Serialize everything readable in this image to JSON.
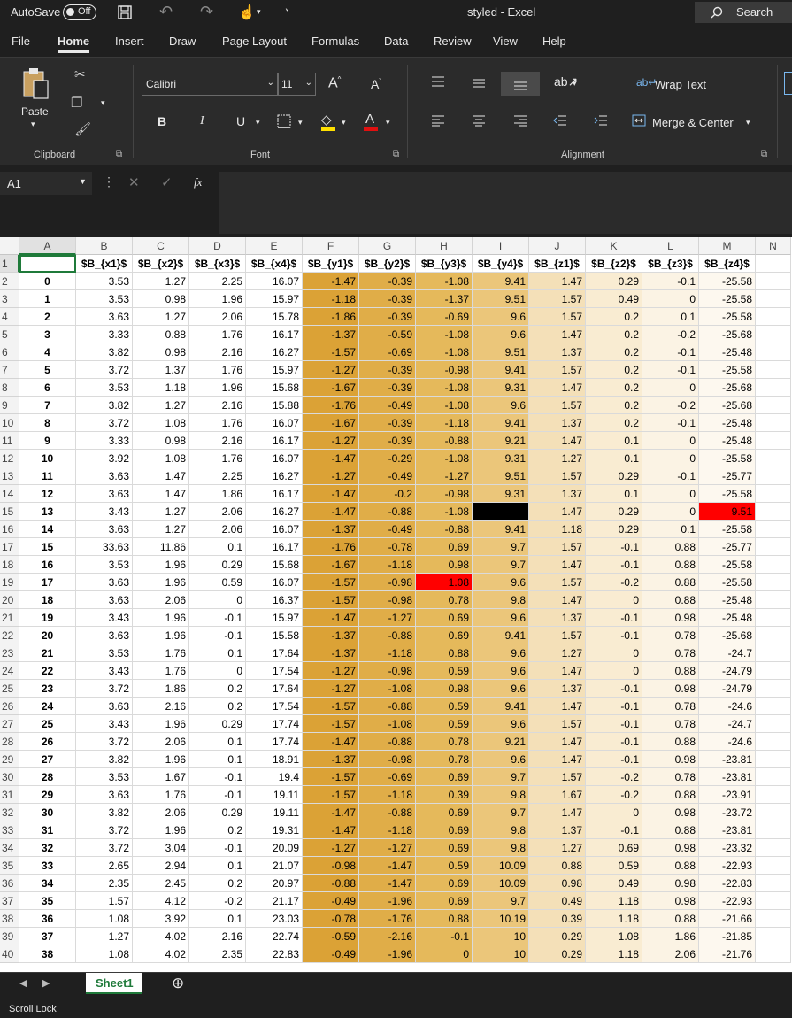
{
  "titlebar": {
    "autosave_label": "AutoSave",
    "autosave_state": "Off",
    "doc_title": "styled  -  Excel",
    "search_placeholder": "Search"
  },
  "menu": {
    "items": [
      "File",
      "Home",
      "Insert",
      "Draw",
      "Page Layout",
      "Formulas",
      "Data",
      "Review",
      "View",
      "Help"
    ],
    "active": "Home"
  },
  "ribbon": {
    "paste_label": "Paste",
    "clipboard_label": "Clipboard",
    "font_name": "Calibri",
    "font_size": "11",
    "font_label": "Font",
    "bold": "B",
    "italic": "I",
    "underline": "U",
    "wrap_text": "Wrap Text",
    "merge_center": "Merge & Center",
    "alignment_label": "Alignment"
  },
  "formula": {
    "name_box": "A1",
    "fx": "fx",
    "content": ""
  },
  "sheet": {
    "col_letters": [
      "A",
      "B",
      "C",
      "D",
      "E",
      "F",
      "G",
      "H",
      "I",
      "J",
      "K",
      "L",
      "M",
      "N"
    ],
    "headers": [
      "",
      "$B_{x1}$",
      "$B_{x2}$",
      "$B_{x3}$",
      "$B_{x4}$",
      "$B_{y1}$",
      "$B_{y2}$",
      "$B_{y3}$",
      "$B_{y4}$",
      "$B_{z1}$",
      "$B_{z2}$",
      "$B_{z3}$",
      "$B_{z4}$"
    ],
    "rows": [
      [
        "0",
        "3.53",
        "1.27",
        "2.25",
        "16.07",
        "-1.47",
        "-0.39",
        "-1.08",
        "9.41",
        "1.47",
        "0.29",
        "-0.1",
        "-25.58"
      ],
      [
        "1",
        "3.53",
        "0.98",
        "1.96",
        "15.97",
        "-1.18",
        "-0.39",
        "-1.37",
        "9.51",
        "1.57",
        "0.49",
        "0",
        "-25.58"
      ],
      [
        "2",
        "3.63",
        "1.27",
        "2.06",
        "15.78",
        "-1.86",
        "-0.39",
        "-0.69",
        "9.6",
        "1.57",
        "0.2",
        "0.1",
        "-25.58"
      ],
      [
        "3",
        "3.33",
        "0.88",
        "1.76",
        "16.17",
        "-1.37",
        "-0.59",
        "-1.08",
        "9.6",
        "1.47",
        "0.2",
        "-0.2",
        "-25.68"
      ],
      [
        "4",
        "3.82",
        "0.98",
        "2.16",
        "16.27",
        "-1.57",
        "-0.69",
        "-1.08",
        "9.51",
        "1.37",
        "0.2",
        "-0.1",
        "-25.48"
      ],
      [
        "5",
        "3.72",
        "1.37",
        "1.76",
        "15.97",
        "-1.27",
        "-0.39",
        "-0.98",
        "9.41",
        "1.57",
        "0.2",
        "-0.1",
        "-25.58"
      ],
      [
        "6",
        "3.53",
        "1.18",
        "1.96",
        "15.68",
        "-1.67",
        "-0.39",
        "-1.08",
        "9.31",
        "1.47",
        "0.2",
        "0",
        "-25.68"
      ],
      [
        "7",
        "3.82",
        "1.27",
        "2.16",
        "15.88",
        "-1.76",
        "-0.49",
        "-1.08",
        "9.6",
        "1.57",
        "0.2",
        "-0.2",
        "-25.68"
      ],
      [
        "8",
        "3.72",
        "1.08",
        "1.76",
        "16.07",
        "-1.67",
        "-0.39",
        "-1.18",
        "9.41",
        "1.37",
        "0.2",
        "-0.1",
        "-25.48"
      ],
      [
        "9",
        "3.33",
        "0.98",
        "2.16",
        "16.17",
        "-1.27",
        "-0.39",
        "-0.88",
        "9.21",
        "1.47",
        "0.1",
        "0",
        "-25.48"
      ],
      [
        "10",
        "3.92",
        "1.08",
        "1.76",
        "16.07",
        "-1.47",
        "-0.29",
        "-1.08",
        "9.31",
        "1.27",
        "0.1",
        "0",
        "-25.58"
      ],
      [
        "11",
        "3.63",
        "1.47",
        "2.25",
        "16.27",
        "-1.27",
        "-0.49",
        "-1.27",
        "9.51",
        "1.57",
        "0.29",
        "-0.1",
        "-25.77"
      ],
      [
        "12",
        "3.63",
        "1.47",
        "1.86",
        "16.17",
        "-1.47",
        "-0.2",
        "-0.98",
        "9.31",
        "1.37",
        "0.1",
        "0",
        "-25.58"
      ],
      [
        "13",
        "3.43",
        "1.27",
        "2.06",
        "16.27",
        "-1.47",
        "-0.88",
        "-1.08",
        "",
        "1.47",
        "0.29",
        "0",
        "9.51"
      ],
      [
        "14",
        "3.63",
        "1.27",
        "2.06",
        "16.07",
        "-1.37",
        "-0.49",
        "-0.88",
        "9.41",
        "1.18",
        "0.29",
        "0.1",
        "-25.58"
      ],
      [
        "15",
        "33.63",
        "11.86",
        "0.1",
        "16.17",
        "-1.76",
        "-0.78",
        "0.69",
        "9.7",
        "1.57",
        "-0.1",
        "0.88",
        "-25.77"
      ],
      [
        "16",
        "3.53",
        "1.96",
        "0.29",
        "15.68",
        "-1.67",
        "-1.18",
        "0.98",
        "9.7",
        "1.47",
        "-0.1",
        "0.88",
        "-25.58"
      ],
      [
        "17",
        "3.63",
        "1.96",
        "0.59",
        "16.07",
        "-1.57",
        "-0.98",
        "1.08",
        "9.6",
        "1.57",
        "-0.2",
        "0.88",
        "-25.58"
      ],
      [
        "18",
        "3.63",
        "2.06",
        "0",
        "16.37",
        "-1.57",
        "-0.98",
        "0.78",
        "9.8",
        "1.47",
        "0",
        "0.88",
        "-25.48"
      ],
      [
        "19",
        "3.43",
        "1.96",
        "-0.1",
        "15.97",
        "-1.47",
        "-1.27",
        "0.69",
        "9.6",
        "1.37",
        "-0.1",
        "0.98",
        "-25.48"
      ],
      [
        "20",
        "3.63",
        "1.96",
        "-0.1",
        "15.58",
        "-1.37",
        "-0.88",
        "0.69",
        "9.41",
        "1.57",
        "-0.1",
        "0.78",
        "-25.68"
      ],
      [
        "21",
        "3.53",
        "1.76",
        "0.1",
        "17.64",
        "-1.37",
        "-1.18",
        "0.88",
        "9.6",
        "1.27",
        "0",
        "0.78",
        "-24.7"
      ],
      [
        "22",
        "3.43",
        "1.76",
        "0",
        "17.54",
        "-1.27",
        "-0.98",
        "0.59",
        "9.6",
        "1.47",
        "0",
        "0.88",
        "-24.79"
      ],
      [
        "23",
        "3.72",
        "1.86",
        "0.2",
        "17.64",
        "-1.27",
        "-1.08",
        "0.98",
        "9.6",
        "1.37",
        "-0.1",
        "0.98",
        "-24.79"
      ],
      [
        "24",
        "3.63",
        "2.16",
        "0.2",
        "17.54",
        "-1.57",
        "-0.88",
        "0.59",
        "9.41",
        "1.47",
        "-0.1",
        "0.78",
        "-24.6"
      ],
      [
        "25",
        "3.43",
        "1.96",
        "0.29",
        "17.74",
        "-1.57",
        "-1.08",
        "0.59",
        "9.6",
        "1.57",
        "-0.1",
        "0.78",
        "-24.7"
      ],
      [
        "26",
        "3.72",
        "2.06",
        "0.1",
        "17.74",
        "-1.47",
        "-0.88",
        "0.78",
        "9.21",
        "1.47",
        "-0.1",
        "0.88",
        "-24.6"
      ],
      [
        "27",
        "3.82",
        "1.96",
        "0.1",
        "18.91",
        "-1.37",
        "-0.98",
        "0.78",
        "9.6",
        "1.47",
        "-0.1",
        "0.98",
        "-23.81"
      ],
      [
        "28",
        "3.53",
        "1.67",
        "-0.1",
        "19.4",
        "-1.57",
        "-0.69",
        "0.69",
        "9.7",
        "1.57",
        "-0.2",
        "0.78",
        "-23.81"
      ],
      [
        "29",
        "3.63",
        "1.76",
        "-0.1",
        "19.11",
        "-1.57",
        "-1.18",
        "0.39",
        "9.8",
        "1.67",
        "-0.2",
        "0.88",
        "-23.91"
      ],
      [
        "30",
        "3.82",
        "2.06",
        "0.29",
        "19.11",
        "-1.47",
        "-0.88",
        "0.69",
        "9.7",
        "1.47",
        "0",
        "0.98",
        "-23.72"
      ],
      [
        "31",
        "3.72",
        "1.96",
        "0.2",
        "19.31",
        "-1.47",
        "-1.18",
        "0.69",
        "9.8",
        "1.37",
        "-0.1",
        "0.88",
        "-23.81"
      ],
      [
        "32",
        "3.72",
        "3.04",
        "-0.1",
        "20.09",
        "-1.27",
        "-1.27",
        "0.69",
        "9.8",
        "1.27",
        "0.69",
        "0.98",
        "-23.32"
      ],
      [
        "33",
        "2.65",
        "2.94",
        "0.1",
        "21.07",
        "-0.98",
        "-1.47",
        "0.59",
        "10.09",
        "0.88",
        "0.59",
        "0.88",
        "-22.93"
      ],
      [
        "34",
        "2.35",
        "2.45",
        "0.2",
        "20.97",
        "-0.88",
        "-1.47",
        "0.69",
        "10.09",
        "0.98",
        "0.49",
        "0.98",
        "-22.83"
      ],
      [
        "35",
        "1.57",
        "4.12",
        "-0.2",
        "21.17",
        "-0.49",
        "-1.96",
        "0.69",
        "9.7",
        "0.49",
        "1.18",
        "0.98",
        "-22.93"
      ],
      [
        "36",
        "1.08",
        "3.92",
        "0.1",
        "23.03",
        "-0.78",
        "-1.76",
        "0.88",
        "10.19",
        "0.39",
        "1.18",
        "0.88",
        "-21.66"
      ],
      [
        "37",
        "1.27",
        "4.02",
        "2.16",
        "22.74",
        "-0.59",
        "-2.16",
        "-0.1",
        "10",
        "0.29",
        "1.08",
        "1.86",
        "-21.85"
      ],
      [
        "38",
        "1.08",
        "4.02",
        "2.35",
        "22.83",
        "-0.49",
        "-1.96",
        "0",
        "10",
        "0.29",
        "1.18",
        "2.06",
        "-21.76"
      ]
    ],
    "row_numbers": [
      "1",
      "2",
      "3",
      "4",
      "5",
      "6",
      "7",
      "8",
      "9",
      "10",
      "11",
      "12",
      "13",
      "14",
      "15",
      "16",
      "17",
      "18",
      "19",
      "20",
      "21",
      "22",
      "23",
      "24",
      "25",
      "26",
      "27",
      "28",
      "29",
      "30",
      "31",
      "32",
      "33",
      "34",
      "35",
      "36",
      "37",
      "38",
      "39",
      "40"
    ],
    "column_colors": {
      "F": "#dba236",
      "G": "#e0ad48",
      "H": "#e5b95b",
      "I": "#ebc67a",
      "J": "#f4e0b8",
      "K": "#f9ecd2",
      "L": "#fbf3e4",
      "M": "#fdf8ef"
    },
    "highlight_colors": {
      "black": "#000000",
      "red": "#ff0000"
    },
    "tab_name": "Sheet1"
  },
  "status": {
    "left": "Scroll Lock"
  }
}
